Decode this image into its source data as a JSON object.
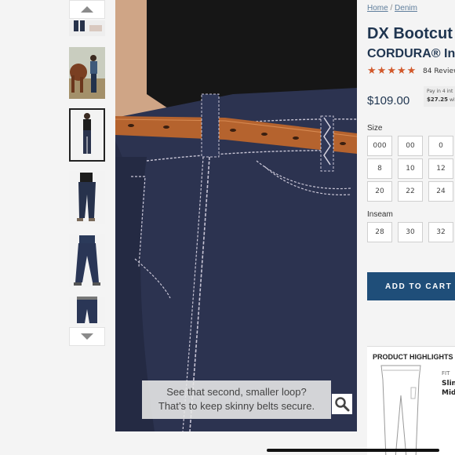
{
  "gallery": {
    "thumbnails": [
      "thumb-1",
      "thumb-2",
      "thumb-3",
      "thumb-4",
      "thumb-5",
      "thumb-6"
    ],
    "active_index": 2
  },
  "main_image": {
    "caption_line1": "See that second, smaller loop?",
    "caption_line2": "That’s to keep skinny belts secure."
  },
  "breadcrumb": {
    "home": "Home",
    "separator": "/",
    "category": "Denim"
  },
  "product": {
    "title_line1": "DX Bootcut",
    "title_line2": "CORDURA® In",
    "rating_stars": 5,
    "reviews": "84 Review",
    "price": "$109.00",
    "installment_line1": "Pay in 4 int",
    "installment_amount": "$27.25",
    "installment_suffix": "wit"
  },
  "size": {
    "label": "Size",
    "options": [
      "000",
      "00",
      "0",
      "8",
      "10",
      "12",
      "20",
      "22",
      "24"
    ]
  },
  "inseam": {
    "label": "Inseam",
    "options": [
      "28",
      "30",
      "32"
    ]
  },
  "cart": {
    "button_label": "ADD TO CART"
  },
  "highlights": {
    "title": "PRODUCT HIGHLIGHTS",
    "fit_label": "FIT",
    "fit_value_line1": "Slim",
    "fit_value_line2": "Mid"
  },
  "colors": {
    "navy": "#1f3550",
    "button": "#1f4e79",
    "star": "#d2582a",
    "link": "#5f7e9c"
  }
}
